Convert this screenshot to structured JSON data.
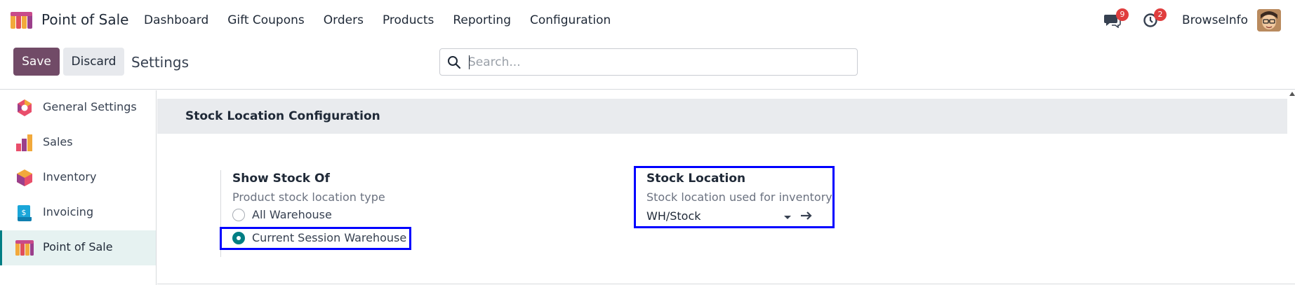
{
  "navbar": {
    "app_name": "Point of Sale",
    "menu": [
      "Dashboard",
      "Gift Coupons",
      "Orders",
      "Products",
      "Reporting",
      "Configuration"
    ],
    "messages_count": "9",
    "activities_count": "2",
    "user_name": "BrowseInfo"
  },
  "control": {
    "save_label": "Save",
    "discard_label": "Discard",
    "title": "Settings",
    "search_placeholder": "Search..."
  },
  "sidebar": {
    "items": [
      {
        "label": "General Settings",
        "icon": "general-settings-icon"
      },
      {
        "label": "Sales",
        "icon": "sales-icon"
      },
      {
        "label": "Inventory",
        "icon": "inventory-icon"
      },
      {
        "label": "Invoicing",
        "icon": "invoicing-icon"
      },
      {
        "label": "Point of Sale",
        "icon": "point-of-sale-icon",
        "active": true
      }
    ]
  },
  "section": {
    "title": "Stock Location Configuration",
    "show_stock": {
      "title": "Show Stock Of",
      "description": "Product stock location type",
      "options": [
        "All Warehouse",
        "Current Session Warehouse"
      ],
      "selected": "Current Session Warehouse"
    },
    "stock_location": {
      "title": "Stock Location",
      "description": "Stock location used for inventory",
      "value": "WH/Stock"
    }
  },
  "colors": {
    "brand": "#714b67",
    "accent": "#017e84",
    "highlight": "#0000ff",
    "badge": "#e03e3e"
  }
}
